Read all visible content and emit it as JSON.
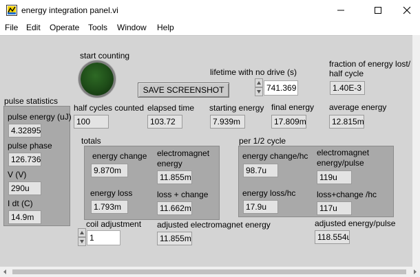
{
  "window": {
    "title": "energy integration panel.vi"
  },
  "menu": {
    "items": [
      "File",
      "Edit",
      "Operate",
      "Tools",
      "Window",
      "Help"
    ]
  },
  "controls": {
    "start_counting": {
      "label": "start counting",
      "state": "off"
    },
    "save_screenshot": {
      "label": "SAVE SCREENSHOT"
    },
    "lifetime": {
      "label": "lifetime with no drive (s)",
      "value": "741.369"
    },
    "coil_adjustment": {
      "label": "coil adjustment",
      "value": "1"
    }
  },
  "indicators": {
    "fraction_lost": {
      "label": "fraction of energy lost/ half cycle",
      "value": "1.40E-3"
    },
    "half_cycles_counted": {
      "label": "half cycles counted",
      "value": "100"
    },
    "elapsed_time": {
      "label": "elapsed time",
      "value": "103.72"
    },
    "starting_energy": {
      "label": "starting energy",
      "value": "7.939m"
    },
    "final_energy": {
      "label": "final energy",
      "value": "17.809m"
    },
    "average_energy": {
      "label": "average energy",
      "value": "12.815m"
    },
    "adjusted_electromagnet_energy": {
      "label": "adjusted electromagnet energy",
      "value": "11.855m"
    },
    "adjusted_energy_per_pulse": {
      "label": "adjusted energy/pulse",
      "value": "118.554u"
    }
  },
  "pulse_statistics": {
    "title": "pulse statistics",
    "items": [
      {
        "label": "pulse energy (uJ)",
        "value": "4.32895"
      },
      {
        "label": "pulse phase",
        "value": "126.736"
      },
      {
        "label": "V (V)",
        "value": "290u"
      },
      {
        "label": "I dt (C)",
        "value": "14.9m"
      }
    ]
  },
  "totals": {
    "title": "totals",
    "energy_change": {
      "label": "energy change",
      "value": "9.870m"
    },
    "electromagnet_energy": {
      "label": "electromagnet energy",
      "value": "11.855m"
    },
    "energy_loss": {
      "label": "energy loss",
      "value": "1.793m"
    },
    "loss_plus_change": {
      "label": "loss + change",
      "value": "11.662m"
    }
  },
  "per_half_cycle": {
    "title": "per 1/2 cycle",
    "energy_change_hc": {
      "label": "energy change/hc",
      "value": "98.7u"
    },
    "electromagnet_energy_pulse": {
      "label": "electromagnet energy/pulse",
      "value": "119u"
    },
    "energy_loss_hc": {
      "label": "energy loss/hc",
      "value": "17.9u"
    },
    "loss_change_hc": {
      "label": "loss+change /hc",
      "value": "117u"
    }
  }
}
